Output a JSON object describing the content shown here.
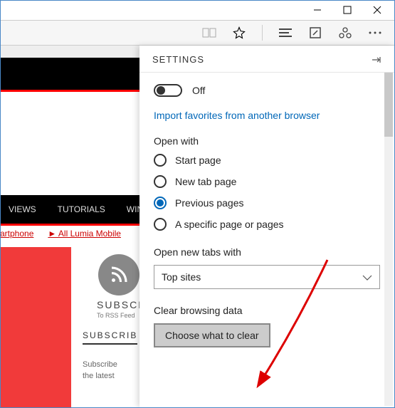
{
  "toolbar": {
    "icons": [
      "book-icon",
      "star-icon",
      "menu-icon",
      "note-icon",
      "share-icon",
      "more-icon"
    ]
  },
  "page": {
    "nav": [
      "VIEWS",
      "TUTORIALS",
      "WIND"
    ],
    "links": [
      "artphone",
      "► All Lumia Mobile"
    ],
    "subscribe_head": "SUBSCRIB",
    "subscribe_small": "To RSS Feed",
    "subscribe2": "SUBSCRIB",
    "subscribe3": "Subscribe",
    "subscribe4": "the latest"
  },
  "panel": {
    "title": "SETTINGS",
    "toggle_label": "Off",
    "import_link": "Import favorites from another browser",
    "open_with_label": "Open with",
    "radios": [
      {
        "label": "Start page",
        "checked": false
      },
      {
        "label": "New tab page",
        "checked": false
      },
      {
        "label": "Previous pages",
        "checked": true
      },
      {
        "label": "A specific page or pages",
        "checked": false
      }
    ],
    "open_tabs_label": "Open new tabs with",
    "select_value": "Top sites",
    "clear_label": "Clear browsing data",
    "clear_button": "Choose what to clear"
  }
}
